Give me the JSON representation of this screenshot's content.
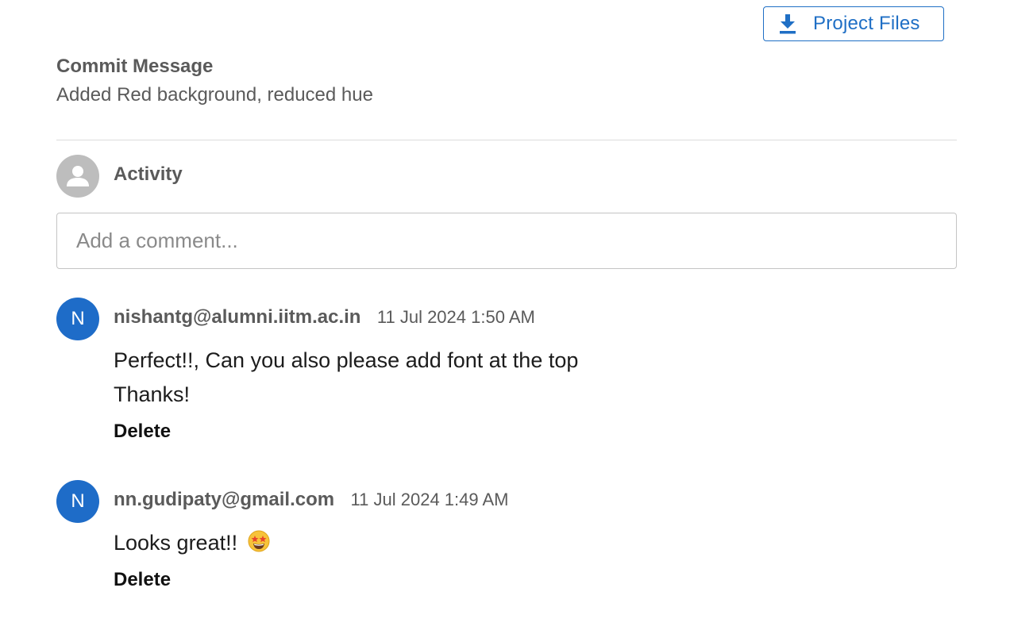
{
  "header": {
    "project_files_label": "Project Files",
    "project_files_icon": "download-icon",
    "accent_color": "#1f6fc5"
  },
  "commit": {
    "heading": "Commit Message",
    "message": "Added Red background, reduced hue"
  },
  "activity": {
    "title": "Activity",
    "avatar_icon": "user-icon",
    "comment_placeholder": "Add a comment..."
  },
  "comments": [
    {
      "avatar_initial": "N",
      "author": "nishantg@alumni.iitm.ac.in",
      "timestamp": "11 Jul 2024 1:50 AM",
      "lines": [
        "Perfect!!, Can you also please add font at the top",
        "Thanks!"
      ],
      "delete_label": "Delete"
    },
    {
      "avatar_initial": "N",
      "author": "nn.gudipaty@gmail.com",
      "timestamp": "11 Jul 2024 1:49 AM",
      "lines": [
        "Looks great!!"
      ],
      "emoji_icon": "star-struck-emoji-icon",
      "delete_label": "Delete"
    }
  ]
}
